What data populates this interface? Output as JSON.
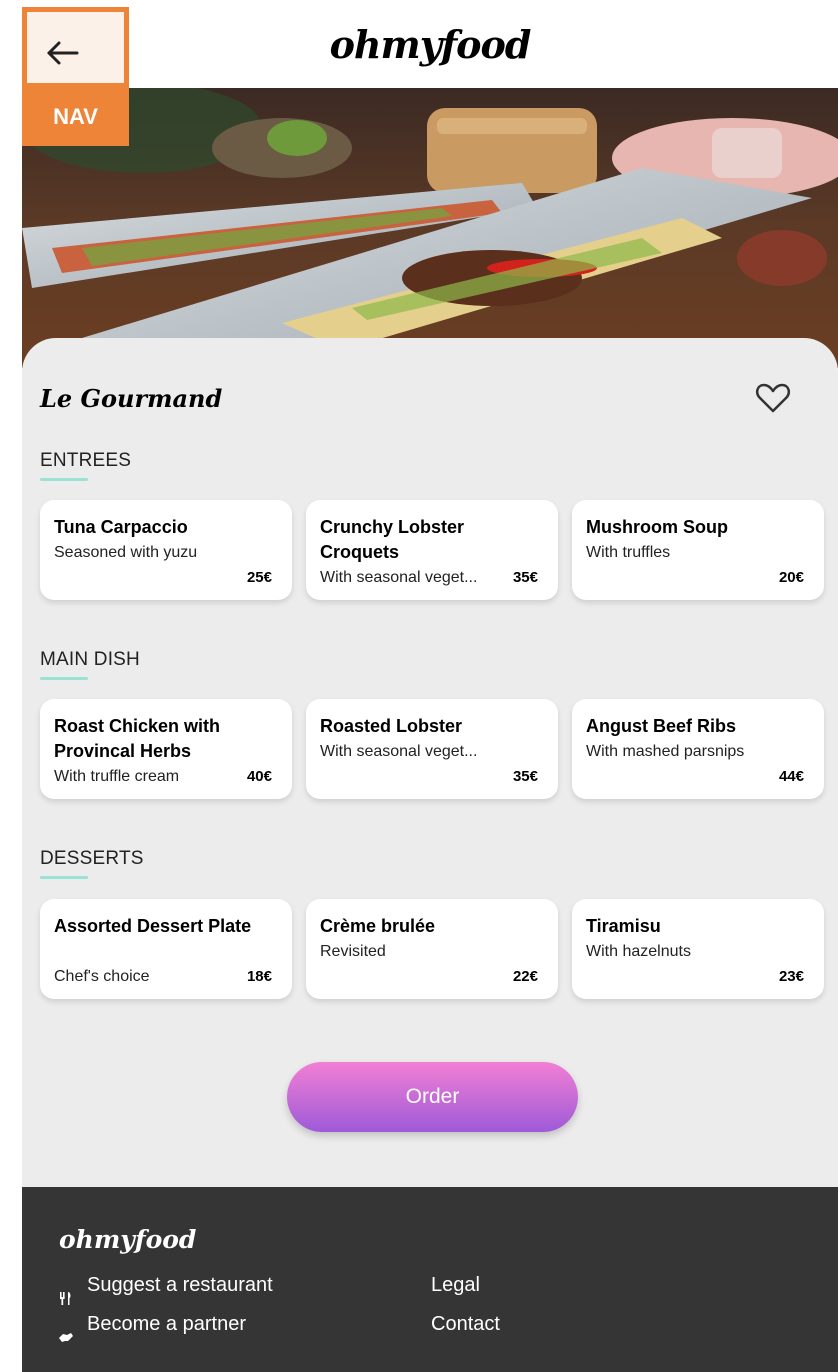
{
  "header": {
    "logo": "ohmyfood",
    "back_icon": "arrow-left-icon",
    "nav_badge": "NAV",
    "accent_color": "#ed8438"
  },
  "restaurant": {
    "name": "Le Gourmand",
    "favorite_icon": "heart-outline-icon"
  },
  "sections": [
    {
      "title": "ENTREES",
      "items": [
        {
          "name": "Tuna Carpaccio",
          "desc": "Seasoned with yuzu",
          "price": "25€"
        },
        {
          "name": "Crunchy Lobster Croquets",
          "desc": "With seasonal veget...",
          "price": "35€"
        },
        {
          "name": "Mushroom Soup",
          "desc": "With truffles",
          "price": "20€"
        }
      ]
    },
    {
      "title": "MAIN DISH",
      "items": [
        {
          "name": "Roast Chicken with Provincal Herbs",
          "desc": "With truffle cream",
          "price": "40€"
        },
        {
          "name": "Roasted Lobster",
          "desc": "With seasonal veget...",
          "price": "35€"
        },
        {
          "name": "Angust Beef Ribs",
          "desc": "With mashed parsnips",
          "price": "44€"
        }
      ]
    },
    {
      "title": "DESSERTS",
      "items": [
        {
          "name": "Assorted Dessert Plate",
          "desc": "Chef's choice",
          "price": "18€"
        },
        {
          "name": "Crème brulée",
          "desc": "Revisited",
          "price": "22€"
        },
        {
          "name": "Tiramisu",
          "desc": "With hazelnuts",
          "price": "23€"
        }
      ]
    }
  ],
  "order_button": "Order",
  "footer": {
    "logo": "ohmyfood",
    "links": {
      "suggest": "Suggest a restaurant",
      "partner": "Become a partner",
      "legal": "Legal",
      "contact": "Contact"
    },
    "icons": {
      "suggest": "utensils-icon",
      "partner": "handshake-icon"
    }
  },
  "colors": {
    "section_underline": "#99e2d4",
    "order_gradient_top": "#f27fd4",
    "order_gradient_bottom": "#9e5ad8",
    "footer_bg": "#353535"
  }
}
